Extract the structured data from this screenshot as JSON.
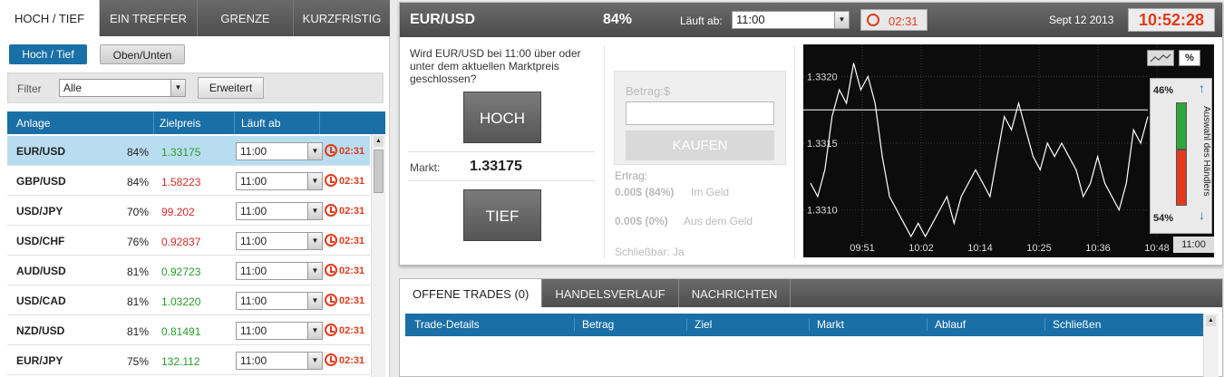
{
  "left_panel": {
    "tabs": [
      "HOCH / TIEF",
      "EIN TREFFER",
      "GRENZE",
      "KURZFRISTIG"
    ],
    "sub_buttons": [
      "Hoch / Tief",
      "Oben/Unten"
    ],
    "filter_label": "Filter",
    "filter_value": "Alle",
    "advanced_button": "Erweitert",
    "table_headers": [
      "Anlage",
      "Zielpreis",
      "Läuft ab"
    ],
    "rows": [
      {
        "pair": "EUR/USD",
        "pct": "84%",
        "price": "1.33175",
        "dir": "up",
        "expiry": "11:00",
        "countdown": "02:31"
      },
      {
        "pair": "GBP/USD",
        "pct": "84%",
        "price": "1.58223",
        "dir": "down",
        "expiry": "11:00",
        "countdown": "02:31"
      },
      {
        "pair": "USD/JPY",
        "pct": "70%",
        "price": "99.202",
        "dir": "down",
        "expiry": "11:00",
        "countdown": "02:31"
      },
      {
        "pair": "USD/CHF",
        "pct": "76%",
        "price": "0.92837",
        "dir": "down",
        "expiry": "11:00",
        "countdown": "02:31"
      },
      {
        "pair": "AUD/USD",
        "pct": "81%",
        "price": "0.92723",
        "dir": "up",
        "expiry": "11:00",
        "countdown": "02:31"
      },
      {
        "pair": "USD/CAD",
        "pct": "81%",
        "price": "1.03220",
        "dir": "up",
        "expiry": "11:00",
        "countdown": "02:31"
      },
      {
        "pair": "NZD/USD",
        "pct": "81%",
        "price": "0.81491",
        "dir": "up",
        "expiry": "11:00",
        "countdown": "02:31"
      },
      {
        "pair": "EUR/JPY",
        "pct": "75%",
        "price": "132.112",
        "dir": "up",
        "expiry": "11:00",
        "countdown": "02:31"
      }
    ]
  },
  "trade_panel": {
    "asset": "EUR/USD",
    "payout": "84%",
    "expires_label": "Läuft ab:",
    "expires_value": "11:00",
    "countdown": "02:31",
    "date": "Sept 12 2013",
    "clock": "10:52:28",
    "question": "Wird EUR/USD bei 11:00 über oder unter dem aktuellen Marktpreis geschlossen?",
    "high_button": "HOCH",
    "low_button": "TIEF",
    "market_label": "Markt:",
    "market_value": "1.33175",
    "amount_placeholder": "Betrag:$",
    "buy_button": "KAUFEN",
    "yield_label": "Ertrag:",
    "in_money_amount": "0.00$ (84%)",
    "in_money_label": "Im Geld",
    "out_money_amount": "0.00$ (0%)",
    "out_money_label": "Aus dem Geld",
    "closable": "Schließbar: Ja",
    "sentiment_label": "Auswahl des Händlers",
    "sentiment_up": "46%",
    "sentiment_down": "54%",
    "percent_toggle": "%",
    "chart_expiry": "11:00"
  },
  "chart_data": {
    "type": "line",
    "title": "",
    "xlabel": "",
    "ylabel": "",
    "x_ticks": [
      "09:51",
      "10:02",
      "10:14",
      "10:25",
      "10:36",
      "10:48"
    ],
    "y_ticks": [
      "1.3320",
      "1.3315",
      "1.3310"
    ],
    "ylim": [
      1.3308,
      1.3322
    ],
    "reference_line": 1.33175,
    "series": [
      {
        "color": "#ffffff",
        "values": [
          1.3312,
          1.3311,
          1.3313,
          1.3317,
          1.3319,
          1.3318,
          1.3321,
          1.3319,
          1.332,
          1.3318,
          1.3314,
          1.3311,
          1.331,
          1.3309,
          1.3308,
          1.3309,
          1.3308,
          1.3309,
          1.331,
          1.3311,
          1.3309,
          1.3311,
          1.3312,
          1.3313,
          1.3312,
          1.3311,
          1.3314,
          1.3317,
          1.3316,
          1.3318,
          1.3316,
          1.3314,
          1.3313,
          1.3315,
          1.3314,
          1.3315,
          1.3314,
          1.3313,
          1.3311,
          1.3312,
          1.3314,
          1.3312,
          1.3311,
          1.331,
          1.3312,
          1.3316,
          1.3315,
          1.3317
        ]
      }
    ]
  },
  "bottom_panel": {
    "tabs": [
      "OFFENE TRADES (0)",
      "HANDELSVERLAUF",
      "NACHRICHTEN"
    ],
    "columns": [
      "Trade-Details",
      "Betrag",
      "Ziel",
      "Markt",
      "Ablauf",
      "Schließen"
    ]
  },
  "colors": {
    "accent": "#1a6fa6",
    "countdown": "#e23b1b",
    "up": "#2a9a2a",
    "down": "#d42a2a"
  }
}
